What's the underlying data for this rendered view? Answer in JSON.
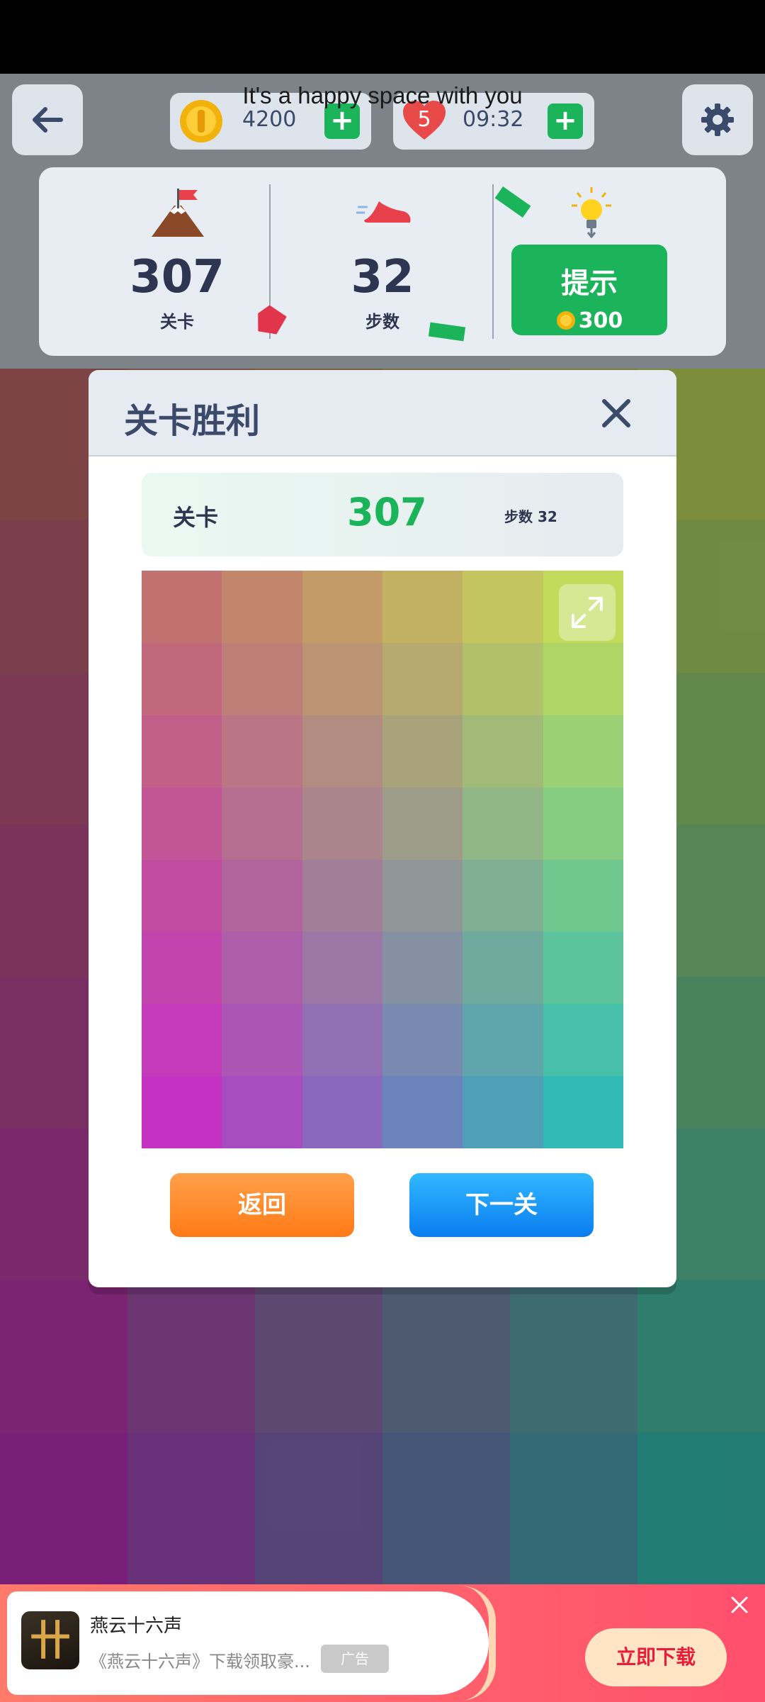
{
  "tagline": "It's a happy space with you",
  "topbar": {
    "coins": "4200",
    "lives": "5",
    "timer": "09:32",
    "plus": "+"
  },
  "stats": {
    "level_value": "307",
    "level_label": "关卡",
    "steps_value": "32",
    "steps_label": "步数",
    "hint_label": "提示",
    "hint_cost": "300"
  },
  "modal": {
    "title": "关卡胜利",
    "level_label": "关卡",
    "level_value": "307",
    "steps_text": "步数 32",
    "back_label": "返回",
    "next_label": "下一关"
  },
  "ad": {
    "title": "燕云十六声",
    "desc": "《燕云十六声》下载领取豪...",
    "tag": "广告",
    "cta": "立即下载"
  },
  "colors": {
    "accent_green": "#1cb45a",
    "back_button": "#ff8a2a",
    "next_button": "#1a93f8",
    "title_text": "#3b4a6b"
  },
  "icons": [
    "back-arrow-icon",
    "coin-icon",
    "heart-icon",
    "gear-icon",
    "flag-mountain-icon",
    "sneaker-icon",
    "lightbulb-icon",
    "close-icon",
    "expand-icon",
    "ad-close-icon"
  ]
}
